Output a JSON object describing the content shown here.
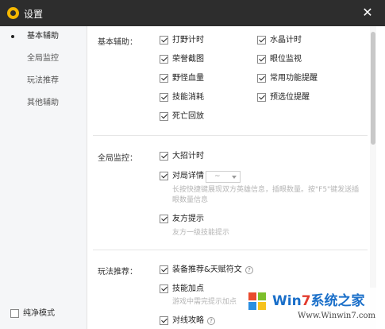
{
  "window": {
    "title": "设置"
  },
  "sidebar": {
    "items": [
      {
        "label": "基本辅助"
      },
      {
        "label": "全局监控"
      },
      {
        "label": "玩法推荐"
      },
      {
        "label": "其他辅助"
      }
    ],
    "pure_mode_label": "纯净模式"
  },
  "sections": {
    "basic": {
      "label": "基本辅助：",
      "options": [
        "打野计时",
        "水晶计时",
        "荣誉截图",
        "眼位监视",
        "野怪血量",
        "常用功能提醒",
        "技能消耗",
        "预选位提醒",
        "死亡回放"
      ]
    },
    "monitor": {
      "label": "全局监控：",
      "opt_ultimate": "大招计时",
      "opt_match_detail": "对局详情",
      "select_value": "~",
      "hint_match_detail": "长按快捷键展现双方英雄信息，插眼数量。按\"F5\"键发送插眼数量信息",
      "opt_ally_tip": "友方提示",
      "hint_ally_tip": "友方一级技能提示"
    },
    "gameplay": {
      "label": "玩法推荐：",
      "opt_equipment": "装备推荐&天赋符文",
      "opt_skill_points": "技能加点",
      "hint_skill_points": "游戏中需完提示加点",
      "opt_lane_strategy": "对线攻略"
    }
  },
  "watermark": {
    "title_a": "Win",
    "title_b": "7",
    "title_c": "系统之家",
    "url": "Www.Winwin7.com"
  },
  "colors": {
    "titlebar": "#2d2d2d",
    "logo": "#f5b800",
    "watermark_blue": "#1a6fc9",
    "watermark_red": "#e23b2e"
  }
}
